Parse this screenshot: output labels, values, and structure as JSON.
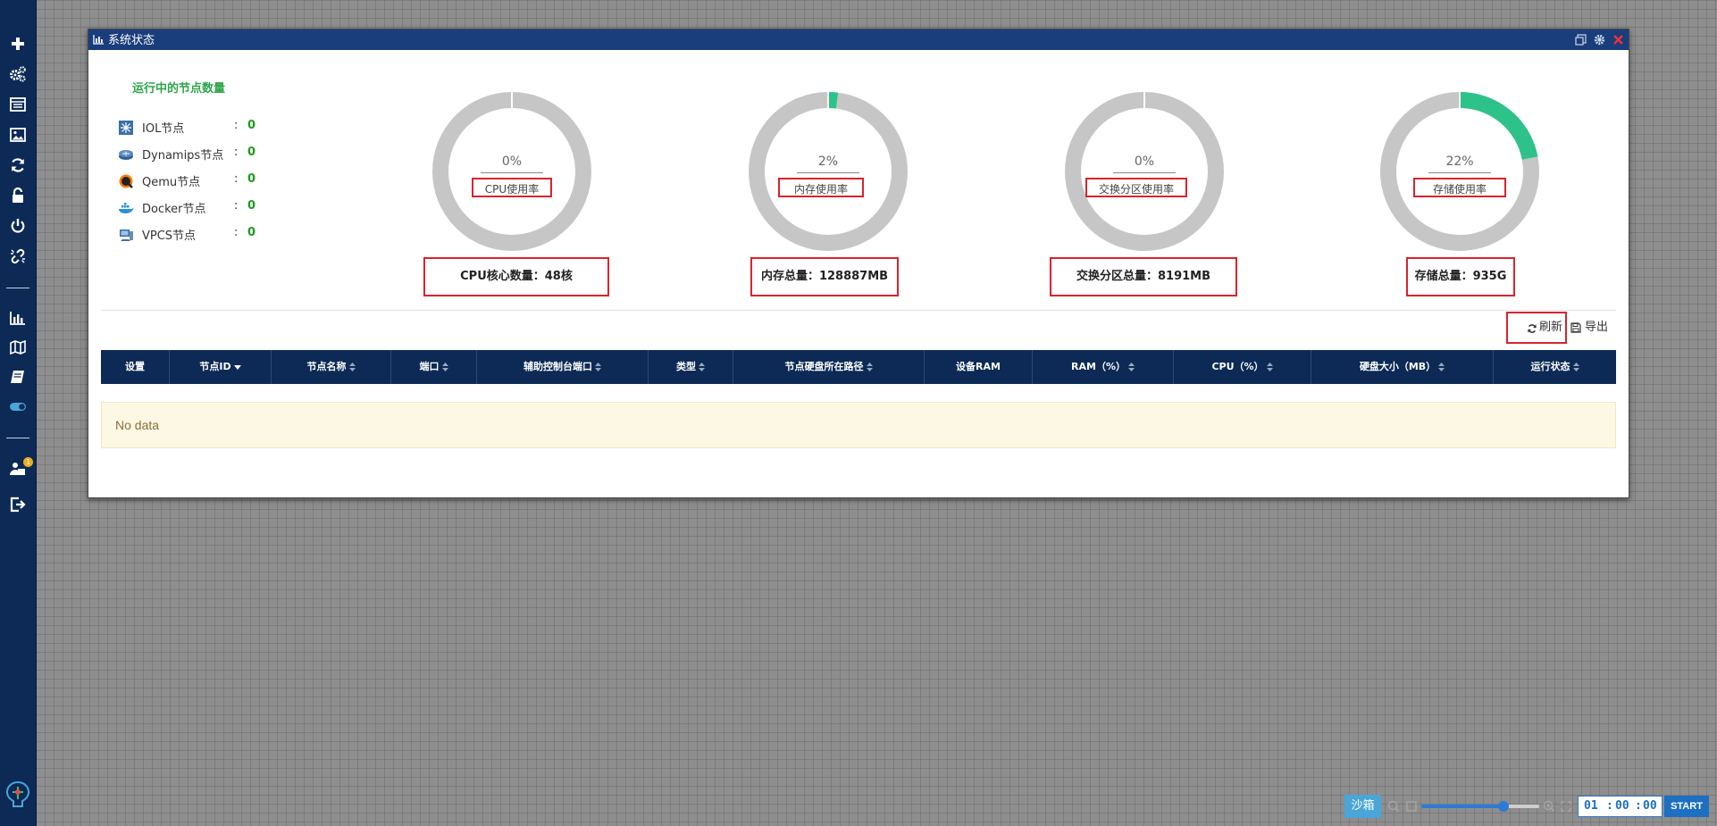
{
  "window": {
    "title": "系统状态"
  },
  "nodes": {
    "title": "运行中的节点数量",
    "items": [
      {
        "label": "IOL节点",
        "value": "0",
        "icon": "iol-switch-icon"
      },
      {
        "label": "Dynamips节点",
        "value": "0",
        "icon": "dynamips-router-icon"
      },
      {
        "label": "Qemu节点",
        "value": "0",
        "icon": "qemu-icon"
      },
      {
        "label": "Docker节点",
        "value": "0",
        "icon": "docker-whale-icon"
      },
      {
        "label": "VPCS节点",
        "value": "0",
        "icon": "vpcs-pc-icon"
      }
    ]
  },
  "gauges": [
    {
      "percent_text": "0%",
      "percent": 0,
      "label": "CPU使用率",
      "total": "CPU核心数量：48核"
    },
    {
      "percent_text": "2%",
      "percent": 2,
      "label": "内存使用率",
      "total": "内存总量：128887MB"
    },
    {
      "percent_text": "0%",
      "percent": 0,
      "label": "交换分区使用率",
      "total": "交换分区总量：8191MB"
    },
    {
      "percent_text": "22%",
      "percent": 22,
      "label": "存储使用率",
      "total": "存储总量：935G"
    }
  ],
  "colors": {
    "gauge_used": "#2ec28b",
    "gauge_free": "#c6c6c6",
    "header_bg": "#0c2a55",
    "highlight_border": "#d9232d",
    "node_count": "#1f9a20"
  },
  "toolbar": {
    "refresh_label": "刷新",
    "export_label": "导出"
  },
  "table": {
    "columns": [
      "设置",
      "节点ID",
      "节点名称",
      "端口",
      "辅助控制台端口",
      "类型",
      "节点硬盘所在路径",
      "设备RAM",
      "RAM（%）",
      "CPU（%）",
      "硬盘大小（MB）",
      "运行状态"
    ],
    "empty_text": "No data"
  },
  "bottom": {
    "sandbox_label": "沙箱",
    "slider_value": 0.7,
    "timer_hours": "01",
    "timer_minutes": "00",
    "timer_seconds": "00",
    "timer_sep": ":",
    "start_label": "START"
  },
  "sidebar": {
    "icons": [
      "add-icon",
      "gears-icon",
      "list-icon",
      "image-icon",
      "refresh-icon",
      "unlock-icon",
      "power-icon",
      "unlink-icon",
      "bar-chart-icon",
      "map-icon",
      "book-icon",
      "toggle-icon",
      "users-icon",
      "logout-icon"
    ],
    "badge": "1"
  }
}
